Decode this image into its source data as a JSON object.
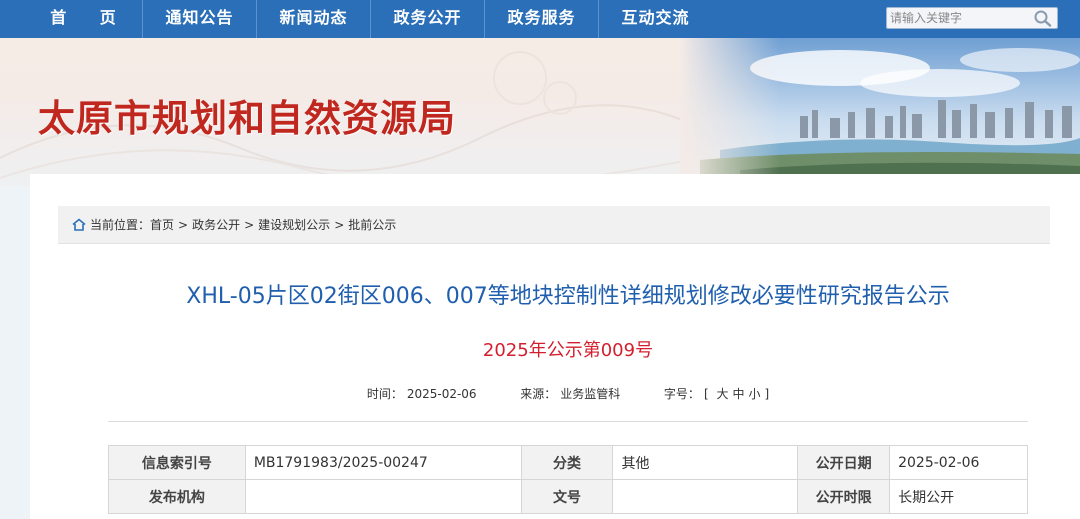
{
  "nav": {
    "items": [
      "首 页",
      "通知公告",
      "新闻动态",
      "政务公开",
      "政务服务",
      "互动交流"
    ]
  },
  "search": {
    "placeholder": "请输入关键字",
    "icon": "search-icon"
  },
  "banner": {
    "title": "太原市规划和自然资源局"
  },
  "breadcrumb": {
    "prefix": "当前位置：",
    "items": [
      "首页",
      "政务公开",
      "建设规划公示",
      "批前公示"
    ],
    "separator": ">"
  },
  "article": {
    "title": "XHL-05片区02街区006、007等地块控制性详细规划修改必要性研究报告公示",
    "doc_number": "2025年公示第009号",
    "time_label": "时间：",
    "time_value": "2025-02-06",
    "source_label": "来源：",
    "source_value": "业务监管科",
    "font_label": "字号：",
    "font_bracket_open": "[",
    "font_large": "大",
    "font_medium": "中",
    "font_small": "小",
    "font_bracket_close": "]"
  },
  "info_table": {
    "rows": [
      [
        "信息索引号",
        "MB1791983/2025-00247",
        "分类",
        "其他",
        "公开日期",
        "2025-02-06"
      ],
      [
        "发布机构",
        "",
        "文号",
        "",
        "公开时限",
        "长期公开"
      ]
    ]
  },
  "colors": {
    "nav_bg": "#2a6fb7",
    "title_red": "#c0281f",
    "article_blue": "#1f5fae",
    "doc_red": "#d41f2e"
  }
}
